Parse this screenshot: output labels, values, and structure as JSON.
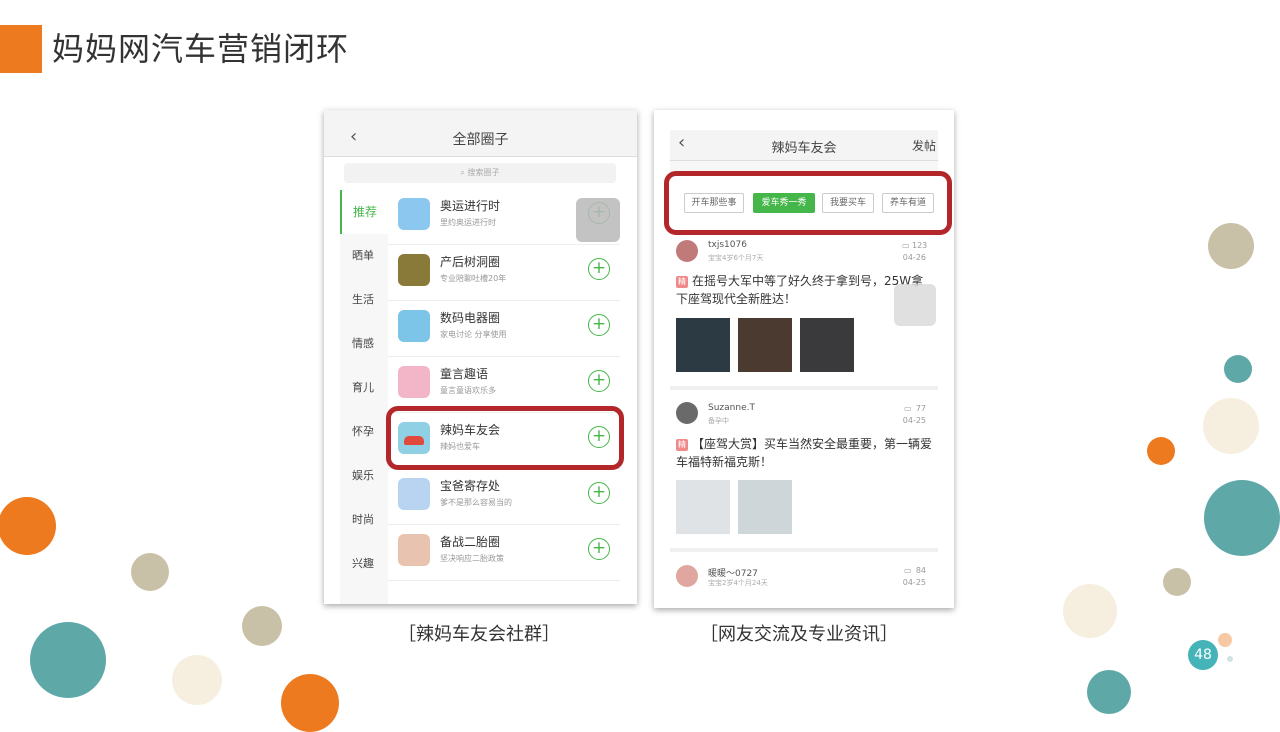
{
  "slide": {
    "title": "妈妈网汽车营销闭环",
    "page_number": "48",
    "accent_color": "#ee7a1f"
  },
  "left_phone": {
    "back_icon": "chevron-left-icon",
    "header_title": "全部圈子",
    "search_placeholder": "搜索圈子",
    "categories": [
      {
        "label": "推荐",
        "active": true
      },
      {
        "label": "晒单"
      },
      {
        "label": "生活"
      },
      {
        "label": "情感"
      },
      {
        "label": "育儿"
      },
      {
        "label": "怀孕"
      },
      {
        "label": "娱乐"
      },
      {
        "label": "时尚"
      },
      {
        "label": "兴趣"
      }
    ],
    "circles": [
      {
        "name": "奥运进行时",
        "desc": "里约奥运进行时"
      },
      {
        "name": "产后树洞圈",
        "desc": "专业陪聊吐槽20年"
      },
      {
        "name": "数码电器圈",
        "desc": "家电讨论 分享使用"
      },
      {
        "name": "童言趣语",
        "desc": "童言童语欢乐多"
      },
      {
        "name": "辣妈车友会",
        "desc": "辣妈也爱车",
        "highlighted": true
      },
      {
        "name": "宝爸寄存处",
        "desc": "爹不是那么容易当的"
      },
      {
        "name": "备战二胎圈",
        "desc": "坚决响应二胎政策"
      }
    ],
    "caption": "［辣妈车友会社群］"
  },
  "right_phone": {
    "back_icon": "chevron-left-icon",
    "header_title": "辣妈车友会",
    "post_button": "发帖",
    "tags": [
      {
        "label": "开车那些事"
      },
      {
        "label": "爱车秀一秀",
        "active": true
      },
      {
        "label": "我要买车"
      },
      {
        "label": "养车有道"
      }
    ],
    "posts": [
      {
        "user": "txjs1076",
        "meta": "宝宝4岁6个月7天",
        "count": "123",
        "date": "04-26",
        "badge": "精",
        "text": "在摇号大军中等了好久终于拿到号，25W拿下座驾现代全新胜达！"
      },
      {
        "user": "Suzanne.T",
        "meta": "备孕中",
        "count": "77",
        "date": "04-25",
        "badge": "精",
        "text": "【座驾大赏】买车当然安全最重要，第一辆爱车福特新福克斯！"
      },
      {
        "user": "暖暖～0727",
        "meta": "宝宝2岁4个月24天",
        "count": "84",
        "date": "04-25"
      }
    ],
    "caption": "［网友交流及专业资讯］"
  },
  "colors": {
    "green": "#45b649",
    "highlight_red": "#b3272a",
    "teal": "#5fa8a8",
    "orange": "#ee7a1f",
    "beige": "#c9c0a8",
    "cream": "#f6efdf"
  }
}
